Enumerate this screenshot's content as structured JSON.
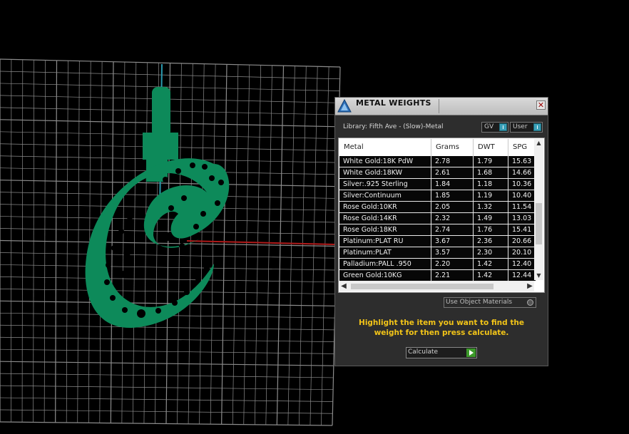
{
  "panel": {
    "title": "METAL WEIGHTS",
    "close_glyph": "✕",
    "library_label": "Library: Fifth Ave - (Slow)-Metal",
    "toggle_gv": "GV",
    "toggle_user": "User",
    "columns": [
      "Metal",
      "Grams",
      "DWT",
      "SPG"
    ],
    "rows": [
      {
        "metal": "White Gold:18K PdW",
        "grams": "2.78",
        "dwt": "1.79",
        "spg": "15.63"
      },
      {
        "metal": "White Gold:18KW",
        "grams": "2.61",
        "dwt": "1.68",
        "spg": "14.66"
      },
      {
        "metal": "Silver:.925 Sterling",
        "grams": "1.84",
        "dwt": "1.18",
        "spg": "10.36"
      },
      {
        "metal": "Silver:Continuum",
        "grams": "1.85",
        "dwt": "1.19",
        "spg": "10.40"
      },
      {
        "metal": "Rose Gold:10KR",
        "grams": "2.05",
        "dwt": "1.32",
        "spg": "11.54"
      },
      {
        "metal": "Rose Gold:14KR",
        "grams": "2.32",
        "dwt": "1.49",
        "spg": "13.03"
      },
      {
        "metal": "Rose Gold:18KR",
        "grams": "2.74",
        "dwt": "1.76",
        "spg": "15.41"
      },
      {
        "metal": "Platinum:PLAT RU",
        "grams": "3.67",
        "dwt": "2.36",
        "spg": "20.66"
      },
      {
        "metal": "Platinum:PLAT",
        "grams": "3.57",
        "dwt": "2.30",
        "spg": "20.10"
      },
      {
        "metal": "Palladium:PALL .950",
        "grams": "2.20",
        "dwt": "1.42",
        "spg": "12.40"
      },
      {
        "metal": "Green Gold:10KG",
        "grams": "2.21",
        "dwt": "1.42",
        "spg": "12.44"
      }
    ],
    "use_object_materials": "Use Object Materials",
    "instructions": "Highlight the item you want to find the weight for then press calculate.",
    "calculate_label": "Calculate"
  },
  "colors": {
    "background": "#000000",
    "model_green": "#0d8a5a",
    "instruction_yellow": "#f2c418",
    "grid_line": "#8c8c8c"
  }
}
